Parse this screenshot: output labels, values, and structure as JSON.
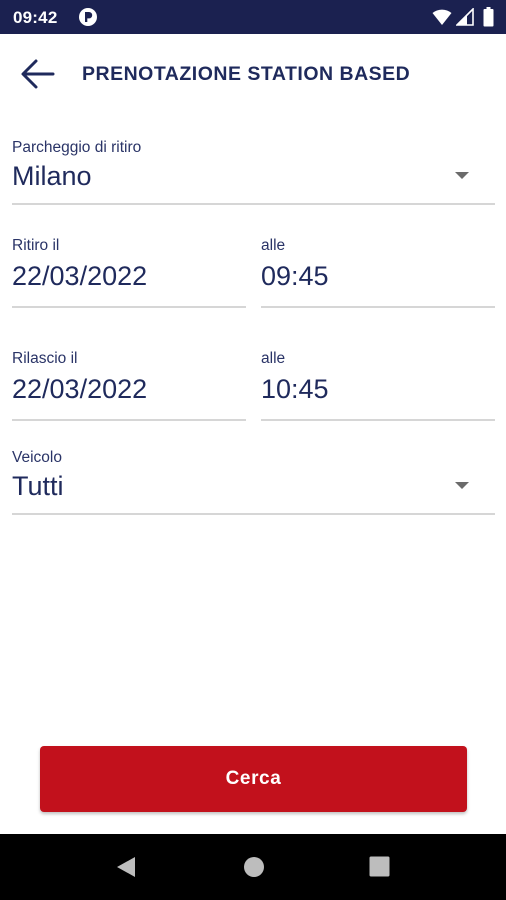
{
  "status_bar": {
    "time": "09:42",
    "icons": [
      "notification-icon",
      "wifi-icon",
      "signal-icon",
      "battery-icon"
    ]
  },
  "header": {
    "title": "PRENOTAZIONE STATION BASED",
    "back_icon": "arrow-back-icon"
  },
  "form": {
    "pickup_parking": {
      "label": "Parcheggio di ritiro",
      "value": "Milano"
    },
    "pickup": {
      "date_label": "Ritiro il",
      "date_value": "22/03/2022",
      "time_label": "alle",
      "time_value": "09:45"
    },
    "return": {
      "date_label": "Rilascio il",
      "date_value": "22/03/2022",
      "time_label": "alle",
      "time_value": "10:45"
    },
    "vehicle": {
      "label": "Veicolo",
      "value": "Tutti"
    }
  },
  "actions": {
    "search_label": "Cerca"
  },
  "nav_bar": {
    "icons": [
      "nav-back-icon",
      "nav-home-icon",
      "nav-recent-icon"
    ]
  },
  "colors": {
    "status_bar": "#1b2150",
    "primary_text": "#1f2a5c",
    "accent_button": "#c2111c",
    "divider": "#d6d6d6",
    "nav_bar": "#000000"
  }
}
